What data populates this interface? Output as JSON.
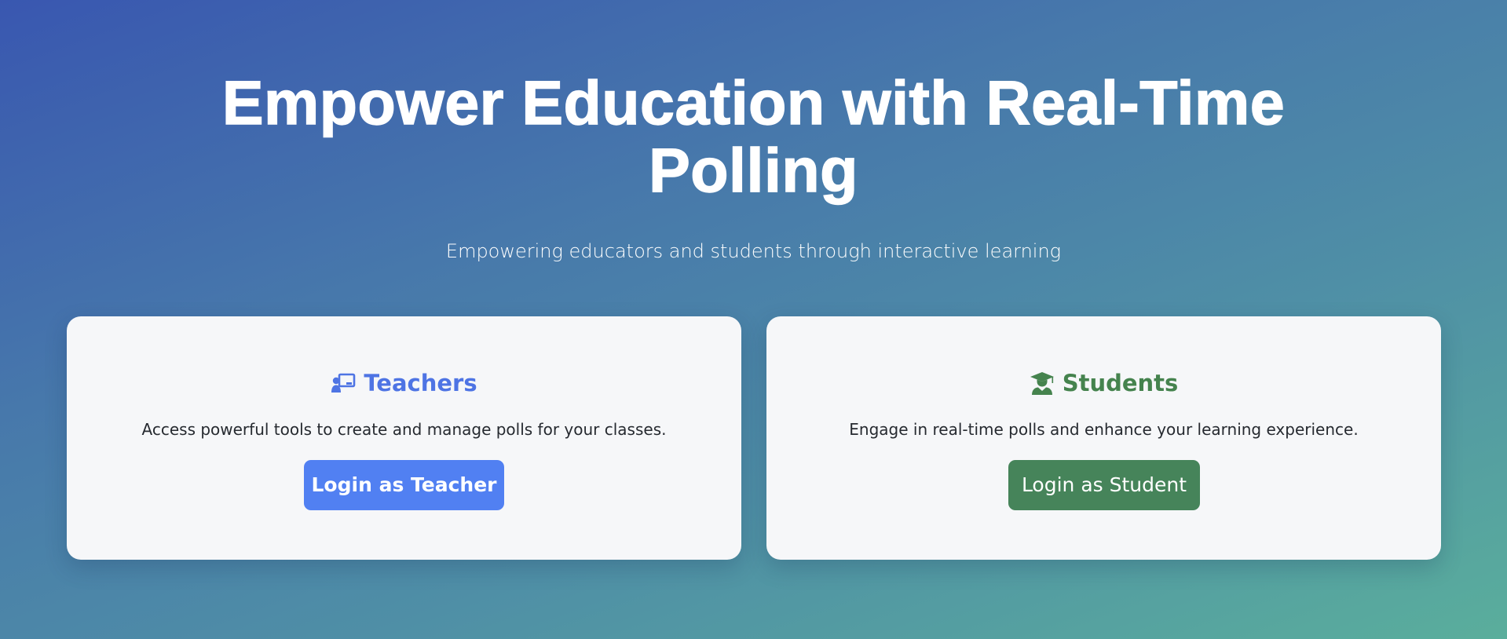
{
  "hero": {
    "title": "Empower Education with Real-Time Polling",
    "subtitle": "Empowering educators and students through interactive learning"
  },
  "cards": [
    {
      "heading": "Teachers",
      "icon": "chalkboard-teacher-icon",
      "description": "Access powerful tools to create and manage polls for your classes.",
      "button_label": "Login as Teacher",
      "accent": "#4e74e4",
      "button_color": "#5180f2"
    },
    {
      "heading": "Students",
      "icon": "graduate-icon",
      "description": "Engage in real-time polls and enhance your learning experience.",
      "button_label": "Login as Student",
      "accent": "#45834e",
      "button_color": "#46845a"
    }
  ],
  "colors": {
    "gradient_start": "#3957b0",
    "gradient_end": "#5aae9c",
    "card_background": "#f6f7f9"
  }
}
